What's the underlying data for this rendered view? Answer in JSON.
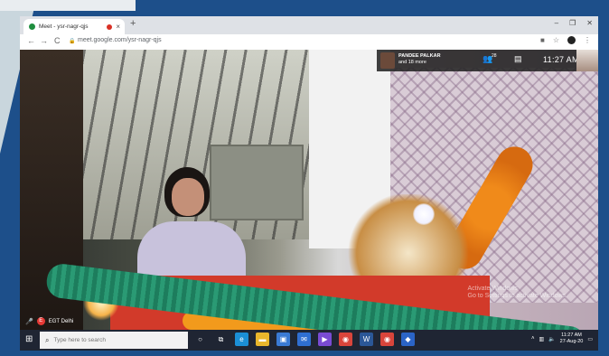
{
  "browser": {
    "tab_title": "Meet - ysr-nagr-qjs",
    "tab_close": "×",
    "new_tab": "+",
    "win_minimize": "–",
    "win_restore": "❐",
    "win_close": "✕",
    "back": "←",
    "forward": "→",
    "reload": "C",
    "url": "meet.google.com/ysr-nagr-qjs"
  },
  "meet": {
    "presenter_name": "PANDEE PALKAR",
    "presenter_sub": "and 18 more",
    "people_count": "28",
    "time": "11:27 AM",
    "user_initial": "E",
    "user_name": "EGT Delhi"
  },
  "watermark": {
    "line1": "Activate Windows",
    "line2": "Go to Settings to activate Windows."
  },
  "taskbar": {
    "search_placeholder": "Type here to search",
    "clock_time": "11:27 AM",
    "clock_date": "27-Aug-20",
    "icons": [
      {
        "name": "cortana-icon",
        "glyph": "○",
        "color": "transparent"
      },
      {
        "name": "task-view-icon",
        "glyph": "⧉",
        "color": "transparent"
      },
      {
        "name": "edge-icon",
        "glyph": "e",
        "color": "#1b8fd6"
      },
      {
        "name": "file-explorer-icon",
        "glyph": "▬",
        "color": "#e8b62c"
      },
      {
        "name": "store-icon",
        "glyph": "▣",
        "color": "#3a7bd5"
      },
      {
        "name": "mail-icon",
        "glyph": "✉",
        "color": "#2f6fd1"
      },
      {
        "name": "media-icon",
        "glyph": "▶",
        "color": "#7a4bd3"
      },
      {
        "name": "chrome-icon",
        "glyph": "◉",
        "color": "#d9453b"
      },
      {
        "name": "word-icon",
        "glyph": "W",
        "color": "#2b5797"
      },
      {
        "name": "chrome-active-icon",
        "glyph": "◉",
        "color": "#d9453b"
      },
      {
        "name": "app-icon",
        "glyph": "◆",
        "color": "#2b64c6"
      }
    ]
  }
}
